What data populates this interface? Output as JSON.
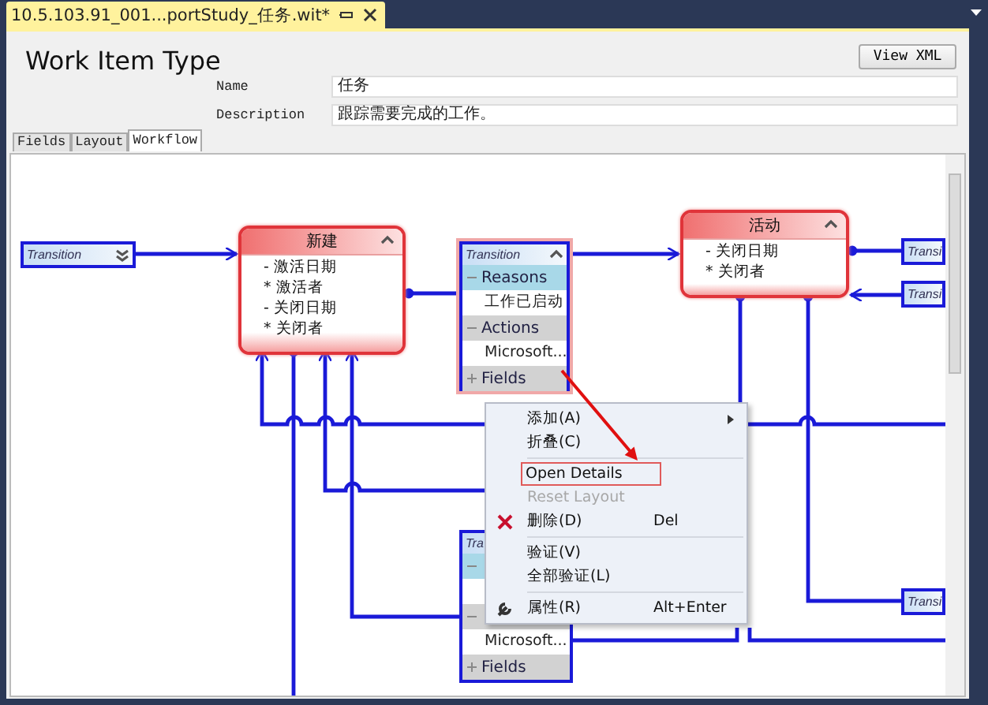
{
  "document_tab": {
    "title": "10.5.103.91_001...portStudy_任务.wit*"
  },
  "header": {
    "title": "Work Item Type",
    "view_xml_button": "View XML"
  },
  "properties": [
    {
      "label": "Name",
      "value": "任务"
    },
    {
      "label": "Description",
      "value": "跟踪需要完成的工作。"
    }
  ],
  "tabs": [
    {
      "label": "Fields",
      "selected": false
    },
    {
      "label": "Layout",
      "selected": false
    },
    {
      "label": "Workflow",
      "selected": true
    }
  ],
  "diagram": {
    "nodes": [
      {
        "kind": "transition",
        "title": "Transition",
        "expanded": false,
        "selected": false
      },
      {
        "kind": "state",
        "title": "新建",
        "fields": [
          "- 激活日期",
          "* 激活者",
          "- 关闭日期",
          "* 关闭者"
        ]
      },
      {
        "kind": "transition",
        "title": "Transition",
        "expanded": true,
        "selected": true,
        "sections": [
          {
            "label": "Reasons",
            "expanded": true,
            "items": [
              "工作已启动"
            ]
          },
          {
            "label": "Actions",
            "expanded": true,
            "items": [
              "Microsoft..."
            ]
          },
          {
            "label": "Fields",
            "expanded": false
          }
        ]
      },
      {
        "kind": "state",
        "title": "活动",
        "fields": [
          "- 关闭日期",
          "* 关闭者"
        ]
      },
      {
        "kind": "transition",
        "title": "Transi",
        "selected": false
      },
      {
        "kind": "transition",
        "title": "Transi",
        "selected": false
      },
      {
        "kind": "transition",
        "title": "Tra",
        "expanded": true,
        "selected": false,
        "sections": [
          {
            "expanded": true
          },
          {
            "expanded": true,
            "items": [
              "Microsoft..."
            ]
          },
          {
            "label": "Fields",
            "expanded": false
          }
        ]
      },
      {
        "kind": "transition",
        "title": "Transi",
        "selected": false
      }
    ]
  },
  "context_menu": [
    {
      "kind": "item",
      "label": "添加(A)",
      "submenu": true,
      "disabled": false
    },
    {
      "kind": "item",
      "label": "折叠(C)",
      "disabled": false
    },
    {
      "kind": "separator"
    },
    {
      "kind": "item",
      "label": "Open Details",
      "outlined": true,
      "disabled": false
    },
    {
      "kind": "item",
      "label": "Reset Layout",
      "disabled": true
    },
    {
      "kind": "item",
      "label": "删除(D)",
      "shortcut": "Del",
      "disabled": false
    },
    {
      "kind": "separator"
    },
    {
      "kind": "item",
      "label": "验证(V)",
      "disabled": false
    },
    {
      "kind": "item",
      "label": "全部验证(L)",
      "disabled": false
    },
    {
      "kind": "separator"
    },
    {
      "kind": "item",
      "label": "属性(R)",
      "shortcut": "Alt+Enter",
      "disabled": false
    }
  ],
  "annotation_arrow": true
}
